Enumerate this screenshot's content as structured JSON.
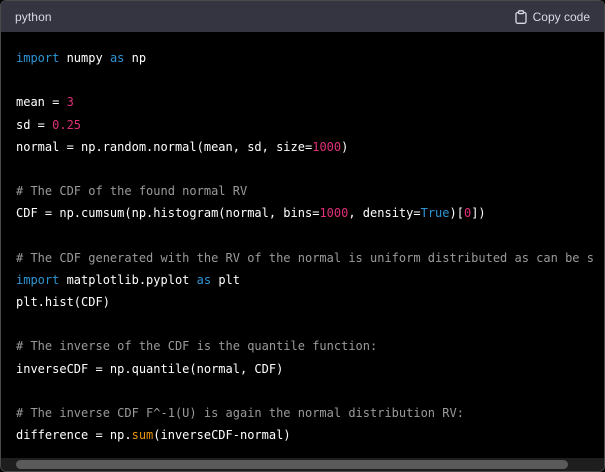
{
  "header": {
    "language": "python",
    "copy_label": "Copy code",
    "icon": "clipboard-icon"
  },
  "code": {
    "lines": [
      [
        {
          "t": "import",
          "c": "kw"
        },
        {
          "t": " numpy ",
          "c": ""
        },
        {
          "t": "as",
          "c": "kw"
        },
        {
          "t": " np",
          "c": ""
        }
      ],
      [],
      [
        {
          "t": "mean = ",
          "c": ""
        },
        {
          "t": "3",
          "c": "num"
        }
      ],
      [
        {
          "t": "sd = ",
          "c": ""
        },
        {
          "t": "0.25",
          "c": "num"
        }
      ],
      [
        {
          "t": "normal = np.random.normal(mean, sd, size=",
          "c": ""
        },
        {
          "t": "1000",
          "c": "num"
        },
        {
          "t": ")",
          "c": ""
        }
      ],
      [],
      [
        {
          "t": "# The CDF of the found normal RV",
          "c": "cm"
        }
      ],
      [
        {
          "t": "CDF = np.cumsum(np.histogram(normal, bins=",
          "c": ""
        },
        {
          "t": "1000",
          "c": "num"
        },
        {
          "t": ", density=",
          "c": ""
        },
        {
          "t": "True",
          "c": "kw"
        },
        {
          "t": ")[",
          "c": ""
        },
        {
          "t": "0",
          "c": "num"
        },
        {
          "t": "])",
          "c": ""
        }
      ],
      [],
      [
        {
          "t": "# The CDF generated with the RV of the normal is uniform distributed as can be s",
          "c": "cm"
        }
      ],
      [
        {
          "t": "import",
          "c": "kw"
        },
        {
          "t": " matplotlib.pyplot ",
          "c": ""
        },
        {
          "t": "as",
          "c": "kw"
        },
        {
          "t": " plt",
          "c": ""
        }
      ],
      [
        {
          "t": "plt.hist(CDF)",
          "c": ""
        }
      ],
      [],
      [
        {
          "t": "# The inverse of the CDF is the quantile function:",
          "c": "cm"
        }
      ],
      [
        {
          "t": "inverseCDF = np.quantile(normal, CDF)",
          "c": ""
        }
      ],
      [],
      [
        {
          "t": "# The inverse CDF F^-1(U) is again the normal distribution RV:",
          "c": "cm"
        }
      ],
      [
        {
          "t": "difference = np.",
          "c": ""
        },
        {
          "t": "sum",
          "c": "bi"
        },
        {
          "t": "(inverseCDF-normal)",
          "c": ""
        }
      ]
    ]
  }
}
